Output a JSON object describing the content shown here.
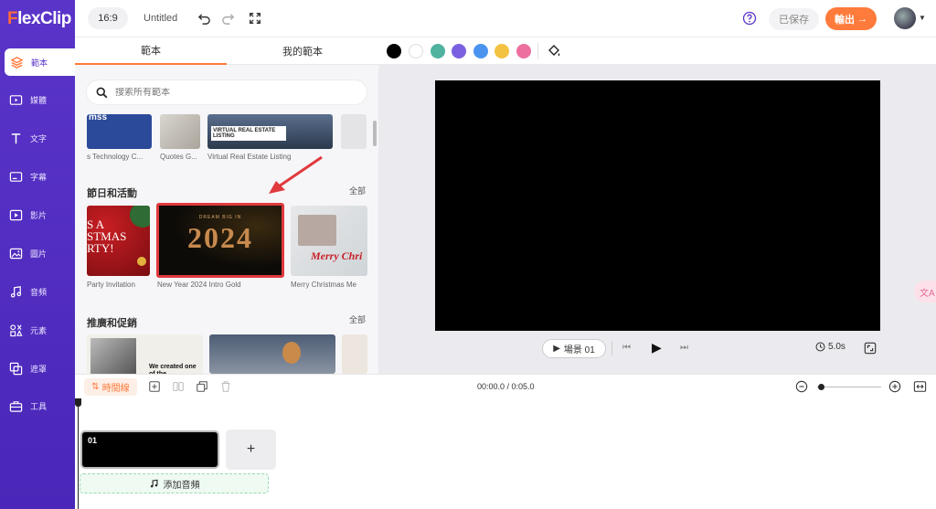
{
  "app": {
    "logo_text": "FlexClip"
  },
  "sidebar": {
    "items": [
      {
        "label": "範本",
        "icon": "layers-icon",
        "active": true
      },
      {
        "label": "媒體",
        "icon": "media-folder-icon"
      },
      {
        "label": "文字",
        "icon": "text-icon"
      },
      {
        "label": "字幕",
        "icon": "subtitle-icon"
      },
      {
        "label": "影片",
        "icon": "video-icon"
      },
      {
        "label": "圖片",
        "icon": "image-icon"
      },
      {
        "label": "音頻",
        "icon": "music-icon"
      },
      {
        "label": "元素",
        "icon": "elements-icon"
      },
      {
        "label": "遮罩",
        "icon": "overlay-icon"
      },
      {
        "label": "工具",
        "icon": "toolbox-icon"
      }
    ]
  },
  "topbar": {
    "aspect_ratio": "16:9",
    "project_title": "Untitled",
    "saved_label": "已保存",
    "export_label": "輸出",
    "export_arrow": "→"
  },
  "panel": {
    "tabs": [
      "範本",
      "我的範本"
    ],
    "search_placeholder": "搜索所有範本",
    "top_row_labels": [
      "s Technology C...",
      "Quotes G...",
      "Virtual Real Estate Listing"
    ],
    "top_row_thumb_text": "VIRTUAL REAL ESTATE LISTING",
    "sections": [
      {
        "title": "節日和活動",
        "all_label": "全部",
        "items": [
          {
            "label": "Party Invitation",
            "thumb_text": "S A\nSTMAS\nRTY!"
          },
          {
            "label": "New Year 2024 Intro Gold",
            "thumb_text": "2024",
            "thumb_small": "DREAM BIG IN"
          },
          {
            "label": "Merry Christmas Me",
            "thumb_text": "Merry Chri"
          }
        ]
      },
      {
        "title": "推廣和促銷",
        "all_label": "全部",
        "items": [
          {
            "label": "",
            "thumb_text": "We created one of the"
          }
        ]
      }
    ]
  },
  "colorbar": {
    "colors": [
      "#000000",
      "#ffffff",
      "#4fb3a0",
      "#7b61e0",
      "#4a94f0",
      "#f4c242",
      "#ec6fa0"
    ]
  },
  "player": {
    "scene_label": "場景 01",
    "duration": "5.0s"
  },
  "floating": {
    "translate_label": "文A"
  },
  "timeline": {
    "toggle_label": "時間線",
    "timecode": "00:00.0 / 0:05.0",
    "clip_label": "01",
    "add_clip": "+",
    "add_audio_label": "添加音頻"
  },
  "theme": {
    "sidebar_color": "#5230c4",
    "accent": "#ff7b3b",
    "highlight": "#e0393e"
  }
}
